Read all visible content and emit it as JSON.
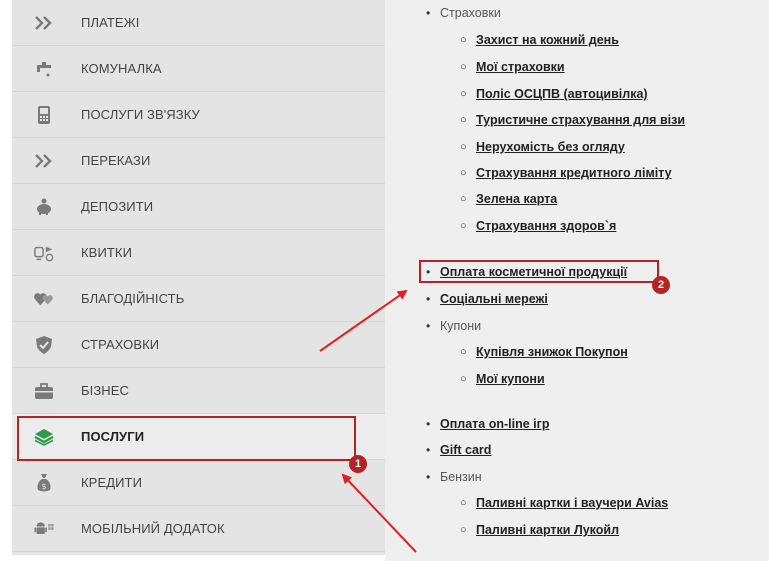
{
  "sidebar": {
    "items": [
      {
        "label": "ПЛАТЕЖІ",
        "icon": "double-chevron-icon",
        "active": false
      },
      {
        "label": "КОМУНАЛКА",
        "icon": "faucet-icon",
        "active": false
      },
      {
        "label": "ПОСЛУГИ ЗВ'ЯЗКУ",
        "icon": "phone-icon",
        "active": false
      },
      {
        "label": "ПЕРЕКАЗИ",
        "icon": "double-chevron-icon",
        "active": false
      },
      {
        "label": "ДЕПОЗИТИ",
        "icon": "piggy-bank-icon",
        "active": false
      },
      {
        "label": "КВИТКИ",
        "icon": "train-plane-icon",
        "active": false
      },
      {
        "label": "БЛАГОДІЙНІСТЬ",
        "icon": "hearts-icon",
        "active": false
      },
      {
        "label": "СТРАХОВКИ",
        "icon": "shield-icon",
        "active": false
      },
      {
        "label": "БІЗНЕС",
        "icon": "briefcase-icon",
        "active": false
      },
      {
        "label": "ПОСЛУГИ",
        "icon": "services-icon",
        "active": true
      },
      {
        "label": "КРЕДИТИ",
        "icon": "money-bag-icon",
        "active": false
      },
      {
        "label": "МОБІЛЬНИЙ ДОДАТОК",
        "icon": "mobile-app-icon",
        "active": false
      }
    ]
  },
  "content": {
    "rows": [
      {
        "level": 1,
        "text": "Страховки",
        "link": false
      },
      {
        "level": 2,
        "text": "Захист на кожний день",
        "link": true
      },
      {
        "level": 2,
        "text": "Мої страховки",
        "link": true
      },
      {
        "level": 2,
        "text": "Поліс ОСЦПВ (автоцивілка)",
        "link": true
      },
      {
        "level": 2,
        "text": "Туристичне страхування для візи",
        "link": true
      },
      {
        "level": 2,
        "text": "Нерухомість без огляду",
        "link": true
      },
      {
        "level": 2,
        "text": "Страхування кредитного ліміту",
        "link": true
      },
      {
        "level": 2,
        "text": "Зелена карта",
        "link": true
      },
      {
        "level": 2,
        "text": "Страхування здоров`я",
        "link": true
      },
      {
        "level": 1,
        "text": "Оплата косметичної продукції",
        "link": true
      },
      {
        "level": 1,
        "text": "Соціальні мережі",
        "link": true
      },
      {
        "level": 1,
        "text": "Купони",
        "link": false
      },
      {
        "level": 2,
        "text": "Купівля знижок Покупон",
        "link": true
      },
      {
        "level": 2,
        "text": "Мої купони",
        "link": true
      },
      {
        "level": 1,
        "text": "Оплата on-line ігр",
        "link": true
      },
      {
        "level": 1,
        "text": "Gift card",
        "link": true
      },
      {
        "level": 1,
        "text": "Бензин",
        "link": false
      },
      {
        "level": 2,
        "text": "Паливні картки і ваучери Avias",
        "link": true
      },
      {
        "level": 2,
        "text": "Паливні картки Лукойл",
        "link": true
      }
    ]
  },
  "annotations": {
    "badge1": "1",
    "badge2": "2",
    "color": "#b52424"
  },
  "theme": {
    "sidebar_bg": "#e4e4e4",
    "icon_gray": "#7a7a7a",
    "active_icon": "#2e9a4a"
  }
}
